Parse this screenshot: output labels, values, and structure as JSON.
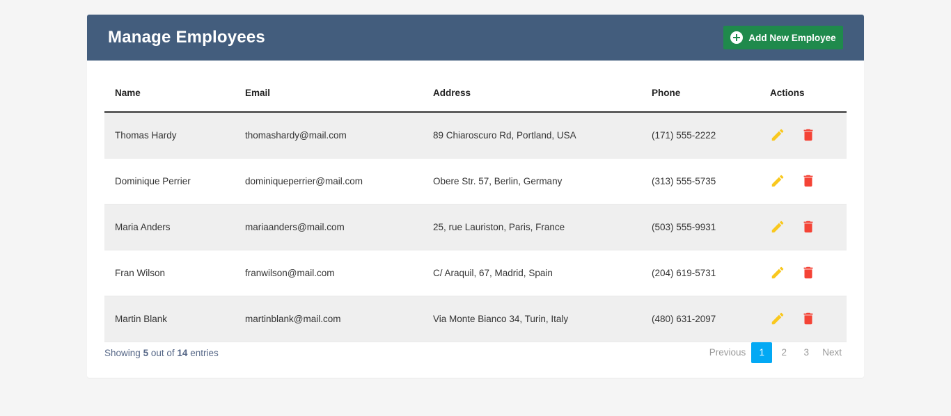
{
  "header": {
    "title_prefix": "Manage",
    "title_bold": "Employees",
    "add_button_label": "Add New Employee"
  },
  "table": {
    "columns": [
      "Name",
      "Email",
      "Address",
      "Phone",
      "Actions"
    ],
    "rows": [
      {
        "name": "Thomas Hardy",
        "email": "thomashardy@mail.com",
        "address": "89 Chiaroscuro Rd, Portland, USA",
        "phone": "(171) 555-2222"
      },
      {
        "name": "Dominique Perrier",
        "email": "dominiqueperrier@mail.com",
        "address": "Obere Str. 57, Berlin, Germany",
        "phone": "(313) 555-5735"
      },
      {
        "name": "Maria Anders",
        "email": "mariaanders@mail.com",
        "address": "25, rue Lauriston, Paris, France",
        "phone": "(503) 555-9931"
      },
      {
        "name": "Fran Wilson",
        "email": "franwilson@mail.com",
        "address": "C/ Araquil, 67, Madrid, Spain",
        "phone": "(204) 619-5731"
      },
      {
        "name": "Martin Blank",
        "email": "martinblank@mail.com",
        "address": "Via Monte Bianco 34, Turin, Italy",
        "phone": "(480) 631-2097"
      }
    ],
    "row_actions": [
      "edit-icon",
      "delete-icon"
    ]
  },
  "footer": {
    "showing_prefix": "Showing",
    "showing_count": "5",
    "showing_mid": "out of",
    "showing_total": "14",
    "showing_suffix": "entries",
    "pagination": {
      "previous": "Previous",
      "pages": [
        "1",
        "2",
        "3"
      ],
      "active_page": "1",
      "next": "Next"
    }
  },
  "colors": {
    "header_bg": "#435d7d",
    "add_button": "#1f8a4c",
    "edit_icon": "#f9c81e",
    "delete_icon": "#f44336",
    "active_page": "#03a9f4"
  }
}
